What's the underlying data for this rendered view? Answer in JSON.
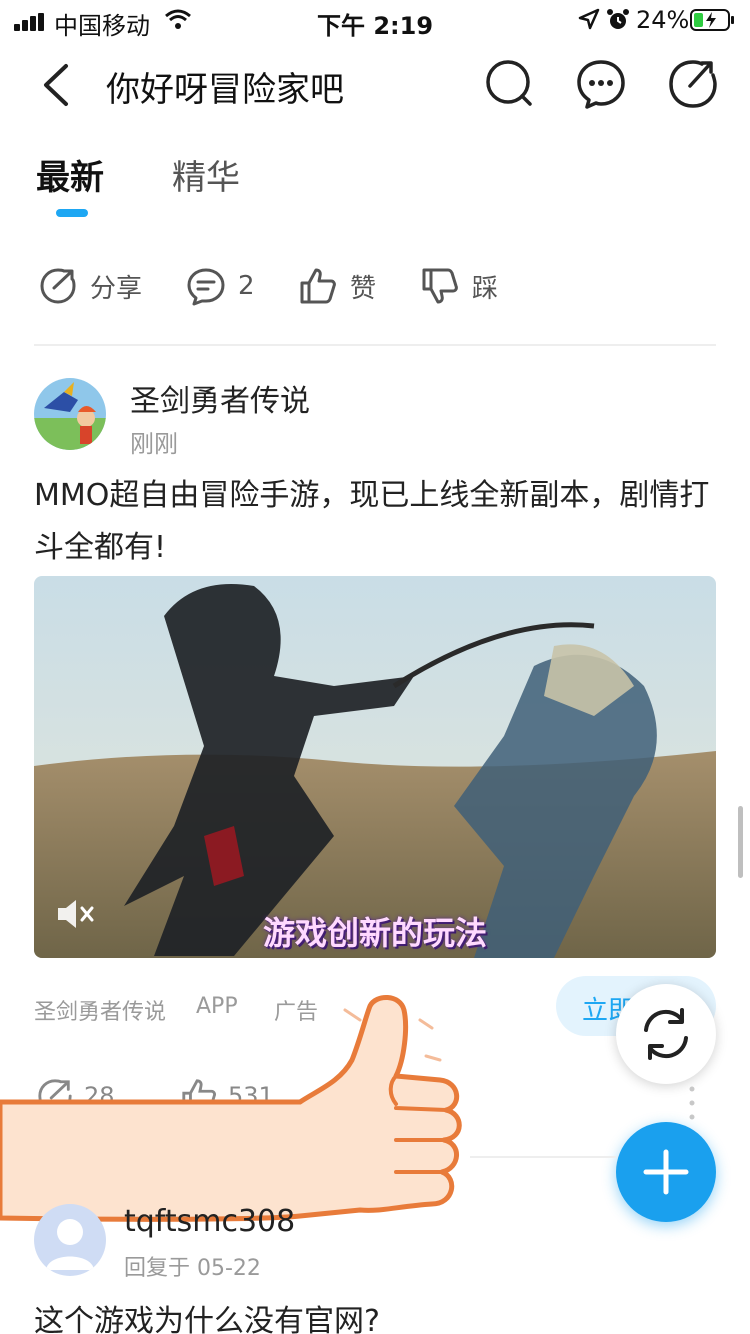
{
  "status_bar": {
    "carrier": "中国移动",
    "time": "下午 2:19",
    "battery": "24%"
  },
  "nav": {
    "title": "你好呀冒险家吧",
    "icons": [
      "back-icon",
      "search-icon",
      "more-icon",
      "share-icon"
    ]
  },
  "tabs": [
    {
      "label": "最新",
      "active": true
    },
    {
      "label": "精华",
      "active": false
    }
  ],
  "actions": {
    "share": "分享",
    "comments": "2",
    "like": "赞",
    "dislike": "踩"
  },
  "ad_post": {
    "author": "圣剑勇者传说",
    "time": "刚刚",
    "text": "MMO超自由冒险手游，现已上线全新副本，剧情打斗全都有!",
    "video_caption": "游戏创新的玩法",
    "source": "圣剑勇者传说",
    "source_type": "APP",
    "ad_label": "广告",
    "cta": "立即",
    "share_count": "28",
    "like_count": "531"
  },
  "reply": {
    "author": "tqftsmc308",
    "meta": "回复于 05-22",
    "text": "这个游戏为什么没有官网?"
  },
  "colors": {
    "accent": "#1ea7f3",
    "fab": "#1aa0ee",
    "hand_stroke": "#e87b3a",
    "hand_fill": "#fde3cf"
  }
}
